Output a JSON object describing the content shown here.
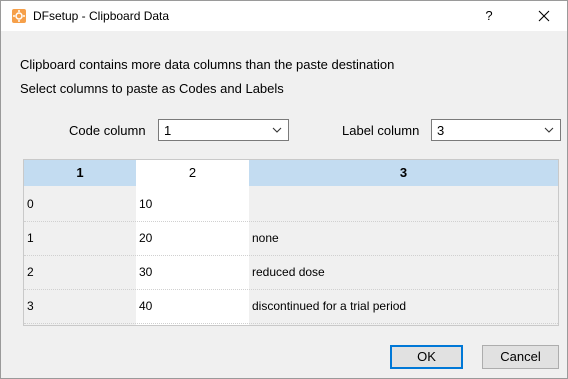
{
  "window": {
    "title": "DFsetup - Clipboard Data",
    "help_glyph": "?",
    "close_glyph": "✕"
  },
  "message": {
    "line1": "Clipboard contains more data columns than the paste destination",
    "line2": "Select columns to paste as Codes and Labels"
  },
  "code_column": {
    "label": "Code column",
    "value": "1"
  },
  "label_column": {
    "label": "Label column",
    "value": "3"
  },
  "table": {
    "headers": [
      "1",
      "2",
      "3"
    ],
    "selected_columns": [
      "1",
      "3"
    ],
    "rows": [
      [
        "0",
        "10",
        ""
      ],
      [
        "1",
        "20",
        "none"
      ],
      [
        "2",
        "30",
        "reduced dose"
      ],
      [
        "3",
        "40",
        "discontinued for a trial period"
      ]
    ]
  },
  "buttons": {
    "ok": "OK",
    "cancel": "Cancel"
  },
  "colors": {
    "selected_header": "#c3dcf1",
    "default_button_border": "#0078d7",
    "app_icon": "#f6a04a"
  },
  "icons": {
    "app": "dfsetup-app-icon",
    "help": "help-icon",
    "close": "close-icon",
    "dropdown": "chevron-down-icon"
  }
}
